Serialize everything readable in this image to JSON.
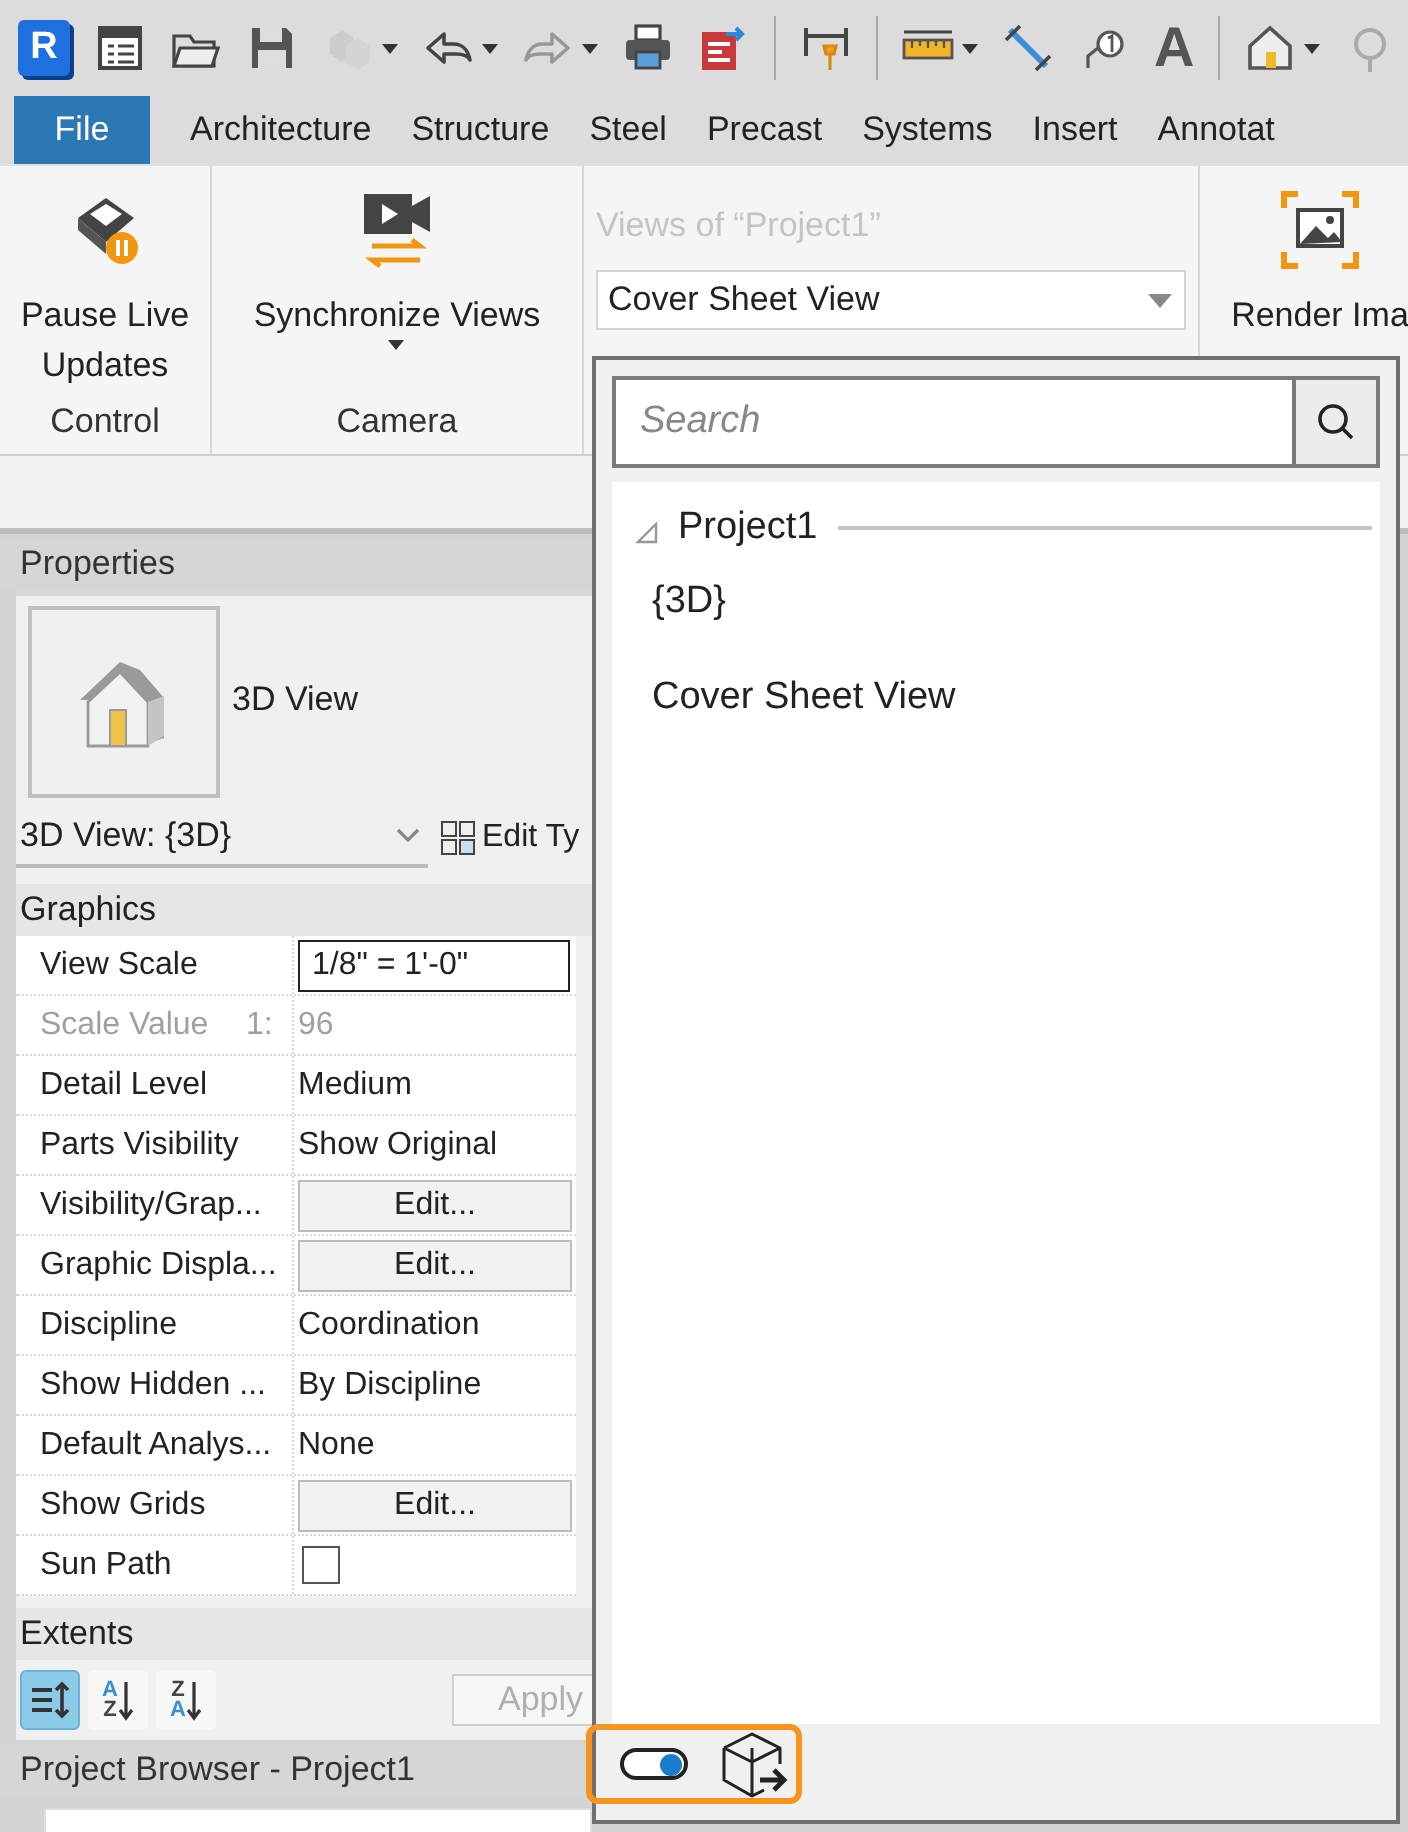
{
  "quick_access": [
    {
      "kind": "logo",
      "glyph": "R",
      "disabled": false,
      "dropdown": false
    },
    {
      "kind": "properties",
      "disabled": false,
      "dropdown": false
    },
    {
      "kind": "open",
      "disabled": false,
      "dropdown": false
    },
    {
      "kind": "save",
      "disabled": false,
      "dropdown": false
    },
    {
      "kind": "sync",
      "disabled": true,
      "dropdown": true
    },
    {
      "kind": "undo",
      "disabled": false,
      "dropdown": true
    },
    {
      "kind": "redo",
      "disabled": true,
      "dropdown": true
    },
    {
      "kind": "print",
      "disabled": false,
      "dropdown": false
    },
    {
      "kind": "export",
      "disabled": false,
      "dropdown": false
    },
    {
      "kind": "separator"
    },
    {
      "kind": "dimension",
      "disabled": false,
      "dropdown": false
    },
    {
      "kind": "separator"
    },
    {
      "kind": "measure",
      "disabled": false,
      "dropdown": true
    },
    {
      "kind": "align",
      "disabled": false,
      "dropdown": false
    },
    {
      "kind": "tag",
      "disabled": false,
      "dropdown": false
    },
    {
      "kind": "text",
      "glyph": "A",
      "disabled": false,
      "dropdown": false
    },
    {
      "kind": "separator"
    },
    {
      "kind": "home",
      "disabled": false,
      "dropdown": true
    },
    {
      "kind": "section",
      "disabled": false,
      "dropdown": false
    }
  ],
  "tabs": [
    {
      "label": "File",
      "selected": true
    },
    {
      "label": "Architecture",
      "selected": false
    },
    {
      "label": "Structure",
      "selected": false
    },
    {
      "label": "Steel",
      "selected": false
    },
    {
      "label": "Precast",
      "selected": false
    },
    {
      "label": "Systems",
      "selected": false
    },
    {
      "label": "Insert",
      "selected": false
    },
    {
      "label": "Annotat",
      "selected": false
    }
  ],
  "ribbon": {
    "panels": [
      {
        "kind": "tools",
        "title": "Control",
        "tools": [
          {
            "label": "Pause Live Updates",
            "dropdown": false
          }
        ]
      },
      {
        "kind": "tools",
        "title": "Camera",
        "tools": [
          {
            "label": "Synchronize Views",
            "dropdown": true
          }
        ]
      },
      {
        "kind": "views",
        "caption": "Views of “Project1”",
        "disabled": true,
        "value": "Cover Sheet View"
      },
      {
        "kind": "tools",
        "tools": [
          {
            "label": "Render Ima",
            "dropdown": false
          }
        ]
      }
    ]
  },
  "properties": {
    "title": "Properties",
    "type_name": "3D View",
    "instance": "3D View: {3D}",
    "edit_type": "Edit Ty",
    "groups": [
      {
        "name": "Graphics",
        "rows": [
          {
            "kind": "input",
            "label": "View Scale",
            "value": "1/8\" = 1'-0\"",
            "disabled": false
          },
          {
            "kind": "text",
            "label": "Scale Value",
            "prefix": "1:",
            "value": "96",
            "disabled": true
          },
          {
            "kind": "text",
            "label": "Detail Level",
            "value": "Medium",
            "disabled": false
          },
          {
            "kind": "text",
            "label": "Parts Visibility",
            "value": "Show Original",
            "disabled": false
          },
          {
            "kind": "button",
            "label": "Visibility/Grap...",
            "value": "Edit...",
            "disabled": false
          },
          {
            "kind": "button",
            "label": "Graphic Displa...",
            "value": "Edit...",
            "disabled": false
          },
          {
            "kind": "text",
            "label": "Discipline",
            "value": "Coordination",
            "disabled": false
          },
          {
            "kind": "text",
            "label": "Show Hidden ...",
            "value": "By Discipline",
            "disabled": false
          },
          {
            "kind": "text",
            "label": "Default Analys...",
            "value": "None",
            "disabled": false
          },
          {
            "kind": "button",
            "label": "Show Grids",
            "value": "Edit...",
            "disabled": false
          },
          {
            "kind": "checkbox",
            "label": "Sun Path",
            "checked": false,
            "disabled": false
          }
        ]
      },
      {
        "name": "Extents"
      }
    ],
    "sort_buttons": [
      {
        "kind": "categorized",
        "selected": true
      },
      {
        "kind": "ascending",
        "top": "A",
        "bottom": "Z",
        "selected": false
      },
      {
        "kind": "descending",
        "top": "Z",
        "bottom": "A",
        "selected": false
      }
    ],
    "apply": {
      "label": "Apply",
      "disabled": true
    }
  },
  "project_browser": {
    "title": "Project Browser - Project1"
  },
  "views_dropdown": {
    "search": {
      "placeholder": "Search"
    },
    "tree": [
      {
        "label": "Project1",
        "expanded": true,
        "children": [
          {
            "label": "{3D}",
            "selected": false
          },
          {
            "label": "Cover Sheet View",
            "selected": false
          }
        ]
      }
    ],
    "footer": {
      "toggle_on": true,
      "highlighted": true
    }
  }
}
